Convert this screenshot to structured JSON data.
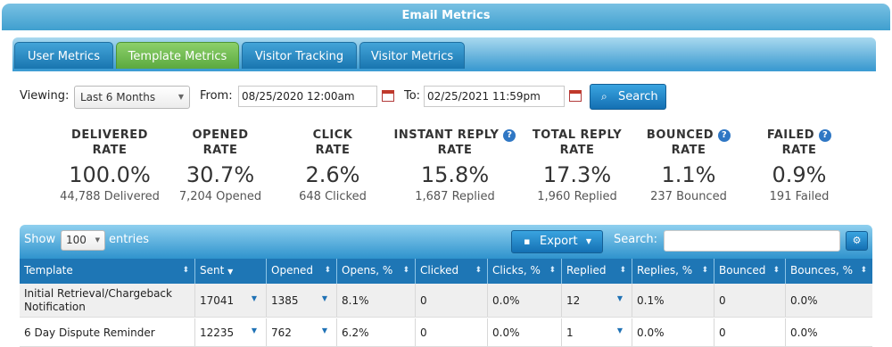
{
  "window": {
    "title": "Email Metrics"
  },
  "tabs": [
    {
      "label": "User Metrics",
      "active": false
    },
    {
      "label": "Template Metrics",
      "active": true
    },
    {
      "label": "Visitor Tracking",
      "active": false
    },
    {
      "label": "Visitor Metrics",
      "active": false
    }
  ],
  "filter": {
    "viewing_label": "Viewing:",
    "viewing_value": "Last 6 Months",
    "from_label": "From:",
    "from_value": "08/25/2020 12:00am",
    "to_label": "To:",
    "to_value": "02/25/2021 11:59pm",
    "search_label": "Search"
  },
  "metrics": [
    {
      "title1": "DELIVERED",
      "title2": "RATE",
      "value": "100.0%",
      "sub": "44,788 Delivered",
      "help": false
    },
    {
      "title1": "OPENED",
      "title2": "RATE",
      "value": "30.7%",
      "sub": "7,204 Opened",
      "help": false
    },
    {
      "title1": "CLICK",
      "title2": "RATE",
      "value": "2.6%",
      "sub": "648 Clicked",
      "help": false
    },
    {
      "title1": "INSTANT REPLY",
      "title2": "RATE",
      "value": "15.8%",
      "sub": "1,687 Replied",
      "help": true
    },
    {
      "title1": "TOTAL REPLY",
      "title2": "RATE",
      "value": "17.3%",
      "sub": "1,960 Replied",
      "help": false
    },
    {
      "title1": "BOUNCED",
      "title2": "RATE",
      "value": "1.1%",
      "sub": "237 Bounced",
      "help": true
    },
    {
      "title1": "FAILED",
      "title2": "RATE",
      "value": "0.9%",
      "sub": "191 Failed",
      "help": true
    }
  ],
  "table": {
    "show_label": "Show",
    "page_size": "100",
    "entries_label": "entries",
    "export_label": "Export",
    "search_label": "Search:",
    "search_value": "",
    "columns": [
      "Template",
      "Sent",
      "Opened",
      "Opens, %",
      "Clicked",
      "Clicks, %",
      "Replied",
      "Replies, %",
      "Bounced",
      "Bounces, %"
    ],
    "rows": [
      [
        "Initial Retrieval/Chargeback Notification",
        "17041",
        "1385",
        "8.1%",
        "0",
        "0.0%",
        "12",
        "0.1%",
        "0",
        "0.0%"
      ],
      [
        "6 Day Dispute Reminder",
        "12235",
        "762",
        "6.2%",
        "0",
        "0.0%",
        "1",
        "0.0%",
        "0",
        "0.0%"
      ]
    ]
  },
  "colors": {
    "accent": "#1e76b5",
    "active_tab": "#58a63c",
    "help_icon": "#2f77c4"
  },
  "icons": [
    "calendar-icon",
    "search-icon",
    "export-icon",
    "gear-icon",
    "help-icon",
    "sort-icon",
    "dropdown-caret-icon"
  ]
}
